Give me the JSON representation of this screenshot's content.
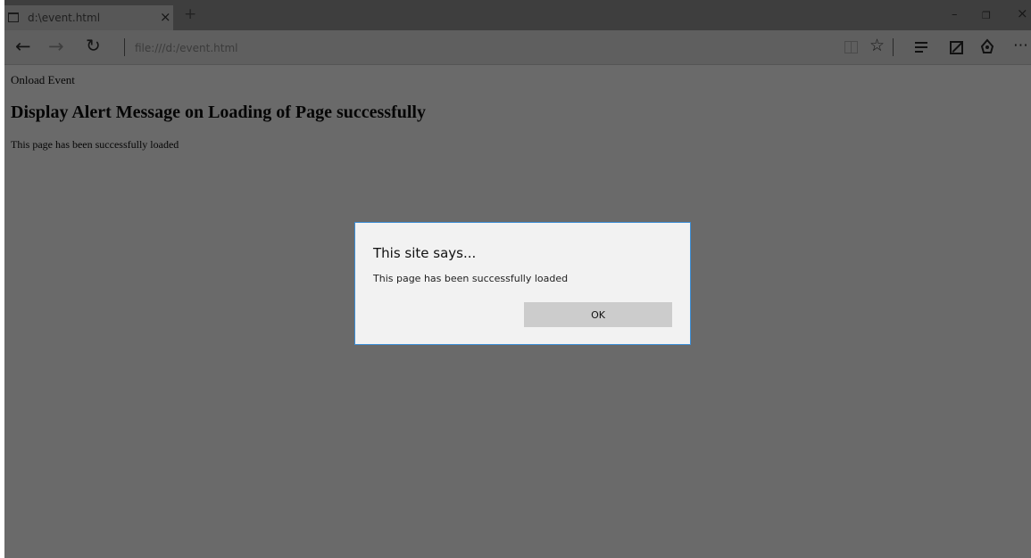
{
  "browser": {
    "tab": {
      "title": "d:\\event.html",
      "close_glyph": "×",
      "icon": "page-icon"
    },
    "new_tab_glyph": "+",
    "window_controls": {
      "minimize": "–",
      "restore": "❐",
      "close": "×"
    },
    "nav": {
      "back": "←",
      "forward": "→",
      "refresh": "↻",
      "address": "file:///d:/event.html",
      "favorite": "☆",
      "more": "⋯",
      "icons": [
        "reading-view-icon",
        "favorite-star-icon",
        "hub-icon",
        "web-note-icon",
        "share-icon",
        "more-icon"
      ]
    }
  },
  "page": {
    "label": "Onload Event",
    "heading": "Display Alert Message on Loading of Page successfully",
    "text": "This page has been successfully loaded"
  },
  "dialog": {
    "title": "This site says...",
    "message": "This page has been successfully loaded",
    "ok_label": "OK"
  },
  "colors": {
    "overlay": "#6a6a6a",
    "tabbar": "#3e3e3e",
    "dialog_bg": "#f2f2f2",
    "dialog_border": "#3c8ed6",
    "ok_button": "#cccccc"
  }
}
